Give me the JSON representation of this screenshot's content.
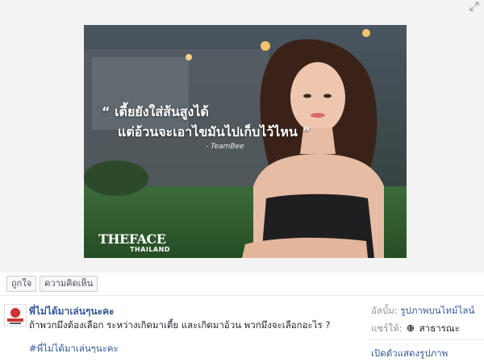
{
  "photo": {
    "quote_line1": "“ เตี้ยยังใส่ส้นสูงได้",
    "quote_line2": "แต่อ้วนจะเอาไขมันไปเก็บไว้ไหน ”",
    "quote_author": "- TeamBee",
    "logo_main": "THEFACE",
    "logo_sub": "THAILAND"
  },
  "actions": {
    "like_label": "ถูกใจ",
    "comment_label": "ความคิดเห็น"
  },
  "post": {
    "page_name": "พี่ไม่ได้มาเล่นๆนะคะ",
    "text": "ถ้าพวกมึงต้องเลือก ระหว่างเกิดมาเตี้ย และเกิดมาอ้วน พวกมึงจะเลือกอะไร ?",
    "hashtag": "#พี่ไม่ได้มาเล่นๆนะคะ"
  },
  "sidebar": {
    "album_label": "อัลบั้ม:",
    "album_value": "รูปภาพบนไทม์ไลน์",
    "shared_label": "แชร์ให้:",
    "shared_value": "สาธารณะ",
    "fullscreen_link": "เปิดตัวแสดงรูปภาพ"
  },
  "icons": {
    "expand": "expand-icon",
    "globe": "globe-icon"
  },
  "colors": {
    "link": "#365899",
    "muted": "#90949c"
  }
}
